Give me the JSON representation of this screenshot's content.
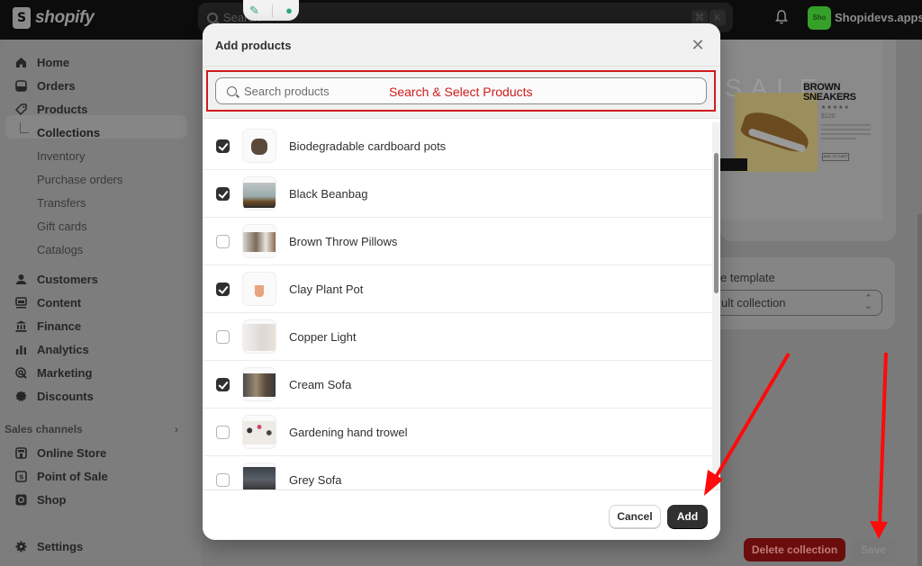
{
  "topbar": {
    "logo_text": "shopify",
    "search_placeholder": "Search",
    "shortcut_keys": [
      "⌘",
      "K"
    ],
    "store_badge": "Sho",
    "store_name": "Shopidevs.apps"
  },
  "sidebar": {
    "items": [
      {
        "label": "Home",
        "icon": "home-icon"
      },
      {
        "label": "Orders",
        "icon": "inbox-icon"
      },
      {
        "label": "Products",
        "icon": "tag-icon"
      }
    ],
    "product_subitems": [
      {
        "label": "Collections",
        "active": true
      },
      {
        "label": "Inventory"
      },
      {
        "label": "Purchase orders"
      },
      {
        "label": "Transfers"
      },
      {
        "label": "Gift cards"
      },
      {
        "label": "Catalogs"
      }
    ],
    "items2": [
      {
        "label": "Customers",
        "icon": "person-icon"
      },
      {
        "label": "Content",
        "icon": "content-icon"
      },
      {
        "label": "Finance",
        "icon": "bank-icon"
      },
      {
        "label": "Analytics",
        "icon": "bar-chart-icon"
      },
      {
        "label": "Marketing",
        "icon": "target-icon"
      },
      {
        "label": "Discounts",
        "icon": "discount-icon"
      }
    ],
    "sales_channels_label": "Sales channels",
    "channels": [
      {
        "label": "Online Store",
        "icon": "store-icon"
      },
      {
        "label": "Point of Sale",
        "icon": "pos-icon"
      },
      {
        "label": "Shop",
        "icon": "shop-icon"
      }
    ],
    "settings_label": "Settings"
  },
  "background": {
    "preview": {
      "sale_text": "SALE",
      "product_title_line1": "BROWN",
      "product_title_line2": "SNEAKERS",
      "stars": "★★★★★",
      "price": "$120",
      "cta": "ADD TO CART"
    },
    "theme_template_label": "Theme template",
    "theme_template_value": "Default collection",
    "delete_button": "Delete collection",
    "save_button": "Save"
  },
  "modal": {
    "title": "Add products",
    "search_placeholder": "Search products",
    "annotation": "Search & Select Products",
    "products": [
      {
        "name": "Biodegradable cardboard pots",
        "checked": true
      },
      {
        "name": "Black Beanbag",
        "checked": true
      },
      {
        "name": "Brown Throw Pillows",
        "checked": false
      },
      {
        "name": "Clay Plant Pot",
        "checked": true
      },
      {
        "name": "Copper Light",
        "checked": false
      },
      {
        "name": "Cream Sofa",
        "checked": true
      },
      {
        "name": "Gardening hand trowel",
        "checked": false
      },
      {
        "name": "Grey Sofa",
        "checked": false
      }
    ],
    "cancel_label": "Cancel",
    "add_label": "Add"
  },
  "colors": {
    "annotation_red": "#d01b1b",
    "primary_button": "#303030",
    "store_badge_green": "#36a12a",
    "destructive": "#8e1010"
  }
}
